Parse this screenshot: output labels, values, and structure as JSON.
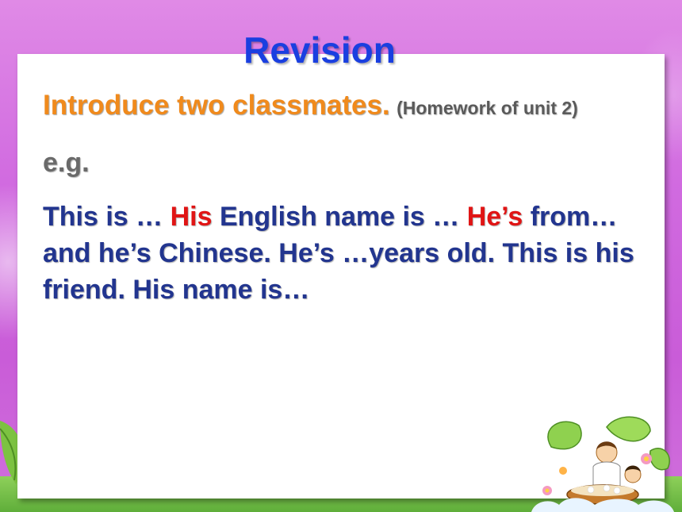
{
  "slide": {
    "title": "Revision",
    "heading": "Introduce two classmates.",
    "heading_note": "(Homework of unit 2)",
    "example_label": "e.g.",
    "body": {
      "part1": "This is … ",
      "his": "His",
      "part2": " English name is … ",
      "hes": "He’s",
      "part3": " from… and he’s Chinese. He’s …years old. This is his friend. His name is…"
    }
  },
  "colors": {
    "title": "#1a3fe0",
    "heading": "#f08a1c",
    "example_label": "#6a6a6a",
    "body": "#22358f",
    "highlight": "#e01515",
    "background": "#d16be0"
  },
  "decorations": {
    "illustration": "children-cooking-clipart",
    "left_leaf": "green-leaf-icon"
  }
}
